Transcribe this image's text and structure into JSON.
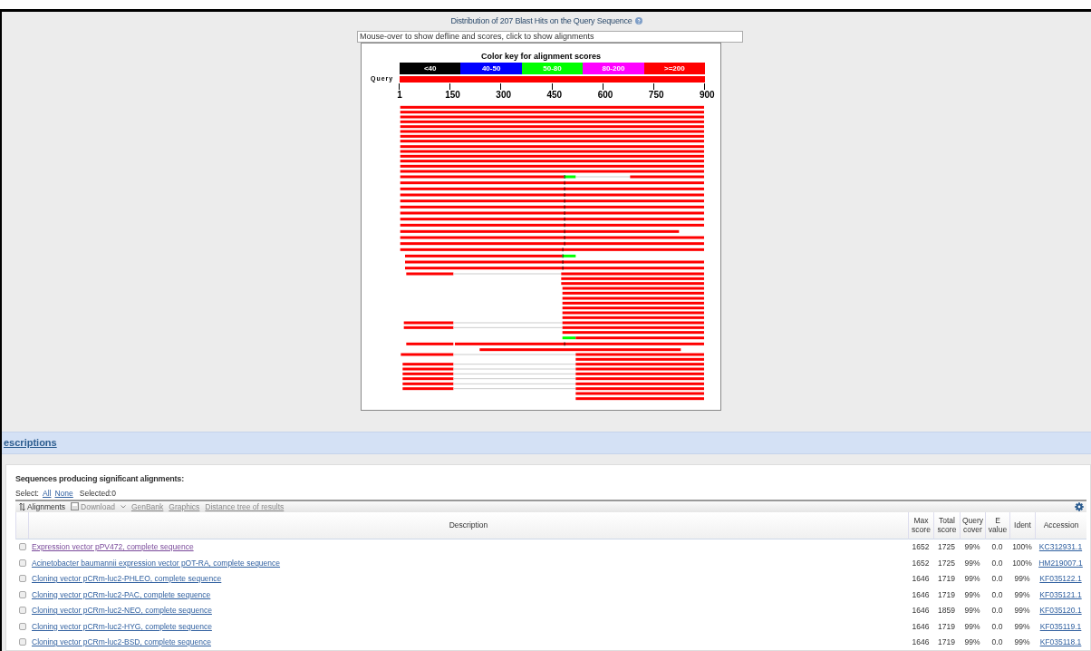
{
  "graphic": {
    "title": "Distribution of 207 Blast Hits on the Query Sequence",
    "info_hint": "Mouse-over to show defline and scores, click to show alignments",
    "key_title": "Color key for alignment scores",
    "key": [
      {
        "label": "<40",
        "color": "#000000"
      },
      {
        "label": "40-50",
        "color": "#0000ff"
      },
      {
        "label": "50-80",
        "color": "#00ff00"
      },
      {
        "label": "80-200",
        "color": "#ff00ff"
      },
      {
        "label": ">=200",
        "color": "#ff0000"
      }
    ],
    "query_label": "Query",
    "ticks": [
      "1",
      "150",
      "300",
      "450",
      "600",
      "750",
      "900"
    ]
  },
  "section": {
    "title": "escriptions"
  },
  "panel": {
    "heading": "Sequences producing significant alignments:",
    "select_label": "Select:",
    "select_links": [
      "All",
      "None"
    ],
    "selected_count": "Selected:0",
    "toolbar": [
      {
        "label": "Alignments",
        "kind": "sort",
        "disabled": false
      },
      {
        "label": "Download",
        "kind": "download",
        "disabled": true
      },
      {
        "label": "GenBank",
        "kind": "link",
        "disabled": true
      },
      {
        "label": "Graphics",
        "kind": "link",
        "disabled": true
      },
      {
        "label": "Distance tree of results",
        "kind": "link",
        "disabled": true
      }
    ]
  },
  "table": {
    "columns": [
      "Description",
      "Max score",
      "Total score",
      "Query cover",
      "E value",
      "Ident",
      "Accession"
    ],
    "rows": [
      {
        "checked": false,
        "visited": true,
        "description": "Expression vector pPV472, complete sequence",
        "max_score": "1652",
        "total_score": "1725",
        "query_cover": "99%",
        "e_value": "0.0",
        "ident": "100%",
        "accession": "KC312931.1"
      },
      {
        "checked": false,
        "visited": false,
        "description": "Acinetobacter baumannii expression vector pOT-RA, complete sequence",
        "max_score": "1652",
        "total_score": "1725",
        "query_cover": "99%",
        "e_value": "0.0",
        "ident": "100%",
        "accession": "HM219007.1"
      },
      {
        "checked": false,
        "visited": false,
        "description": "Cloning vector pCRm-luc2-PHLEO, complete sequence",
        "max_score": "1646",
        "total_score": "1719",
        "query_cover": "99%",
        "e_value": "0.0",
        "ident": "99%",
        "accession": "KF035122.1"
      },
      {
        "checked": false,
        "visited": false,
        "description": "Cloning vector pCRm-luc2-PAC, complete sequence",
        "max_score": "1646",
        "total_score": "1719",
        "query_cover": "99%",
        "e_value": "0.0",
        "ident": "99%",
        "accession": "KF035121.1"
      },
      {
        "checked": false,
        "visited": false,
        "description": "Cloning vector pCRm-luc2-NEO, complete sequence",
        "max_score": "1646",
        "total_score": "1859",
        "query_cover": "99%",
        "e_value": "0.0",
        "ident": "99%",
        "accession": "KF035120.1"
      },
      {
        "checked": false,
        "visited": false,
        "description": "Cloning vector pCRm-luc2-HYG, complete sequence",
        "max_score": "1646",
        "total_score": "1719",
        "query_cover": "99%",
        "e_value": "0.0",
        "ident": "99%",
        "accession": "KF035119.1"
      },
      {
        "checked": false,
        "visited": false,
        "description": "Cloning vector pCRm-luc2-BSD, complete sequence",
        "max_score": "1646",
        "total_score": "1719",
        "query_cover": "99%",
        "e_value": "0.0",
        "ident": "99%",
        "accession": "KF035118.1"
      }
    ]
  }
}
